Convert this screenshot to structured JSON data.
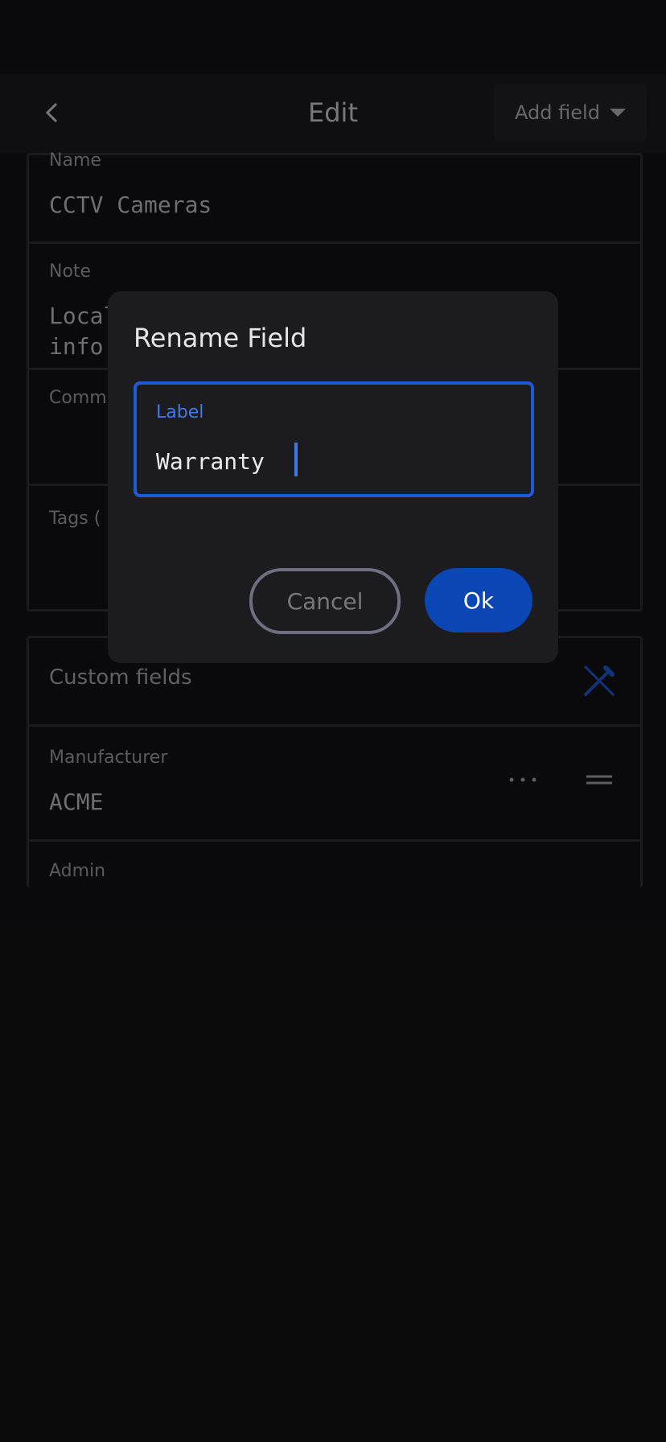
{
  "header": {
    "title": "Edit",
    "add_field_label": "Add field"
  },
  "form": {
    "name": {
      "label": "Name",
      "value": "CCTV Cameras"
    },
    "note": {
      "label": "Note",
      "value_line1": "Local",
      "value_line2": "info"
    },
    "comment": {
      "label": "Comm"
    },
    "tags": {
      "label": "Tags ("
    }
  },
  "custom_fields": {
    "header": "Custom fields",
    "items": [
      {
        "label": "Manufacturer",
        "value": "ACME"
      },
      {
        "label": "Admin"
      }
    ]
  },
  "dialog": {
    "title": "Rename Field",
    "input_label": "Label",
    "input_value": "Warranty",
    "cancel_label": "Cancel",
    "ok_label": "Ok"
  },
  "colors": {
    "accent": "#1d5ad6",
    "ok_button": "#0a47b5",
    "background": "#0c0c0e"
  },
  "icons": {
    "back": "chevron-left-icon",
    "dropdown": "triangle-down-icon",
    "edit": "pencil-crossed-icon",
    "more": "more-horizontal-icon",
    "drag": "drag-handle-icon"
  }
}
